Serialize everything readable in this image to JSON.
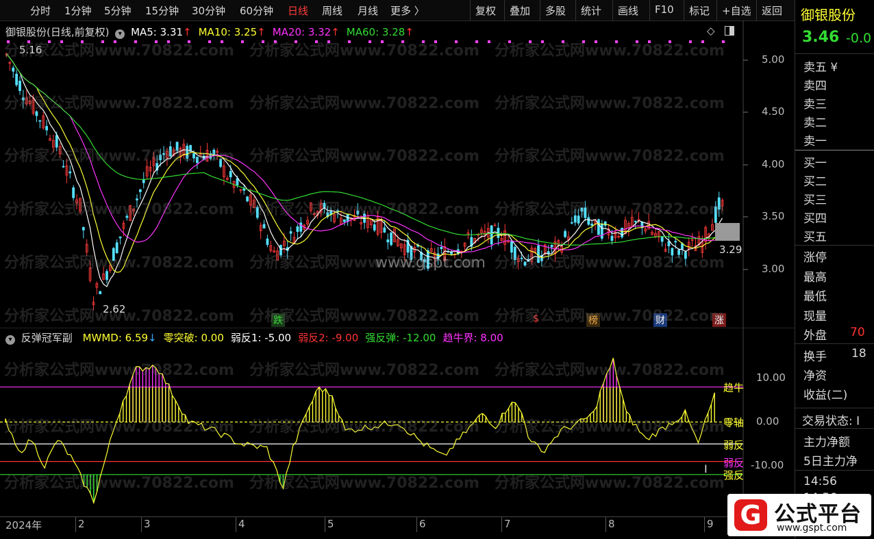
{
  "toolbar": {
    "periods": [
      "分时",
      "1分钟",
      "5分钟",
      "15分钟",
      "30分钟",
      "60分钟",
      "日线",
      "周线",
      "月线",
      "更多 〉"
    ],
    "active_index": 6,
    "actions": [
      "复权",
      "叠加",
      "多股",
      "统计",
      "画线",
      "F10",
      "标记",
      "+自选",
      "返回"
    ]
  },
  "main": {
    "stock_name": "御银股份",
    "mode": "(日线,前复权)",
    "ma": [
      {
        "label": "MA5: 3.31",
        "color": "#ffffff"
      },
      {
        "label": "MA10: 3.25",
        "color": "#ffff33"
      },
      {
        "label": "MA20: 3.32",
        "color": "#ff33ff"
      },
      {
        "label": "MA60: 3.28",
        "color": "#33dd33"
      }
    ],
    "yticks": [
      "5.00",
      "4.50",
      "4.00",
      "3.50",
      "3.00"
    ],
    "annot_high": "5.16",
    "annot_low": "2.62",
    "annot_last": "3.29",
    "center_watermark": "www.gspt.com",
    "events": [
      {
        "label": "跌",
        "color": "#33dd33",
        "bg": "#1a3a1a"
      },
      {
        "label": "$",
        "color": "#ff3333",
        "bg": "#000000"
      },
      {
        "label": "榜",
        "color": "#ffaa33",
        "bg": "#3a2a10"
      },
      {
        "label": "财",
        "color": "#ffffff",
        "bg": "#1a3a7a"
      },
      {
        "label": "涨",
        "color": "#ffffff",
        "bg": "#7a1a1a"
      }
    ]
  },
  "sub": {
    "name": "反弹冠军副",
    "items": [
      {
        "label": "MWMD: 6.59",
        "color": "#ffff33"
      },
      {
        "label": "零突破: 0.00",
        "color": "#ffff33"
      },
      {
        "label": "弱反1: -5.00",
        "color": "#ffffff"
      },
      {
        "label": "弱反2: -9.00",
        "color": "#ff3333"
      },
      {
        "label": "强反弹: -12.00",
        "color": "#33dd33"
      },
      {
        "label": "趋牛界: 8.00",
        "color": "#ff33ff"
      }
    ],
    "yticks": [
      "10.00",
      "0.00",
      "-10.00"
    ],
    "line_labels": [
      {
        "label": "趋牛",
        "color": "#ffff33"
      },
      {
        "label": "零轴",
        "color": "#ffff33"
      },
      {
        "label": "弱反",
        "color": "#ffff33"
      },
      {
        "label": "弱反",
        "color": "#ff33ff"
      },
      {
        "label": "强反",
        "color": "#ffff33"
      }
    ]
  },
  "xaxis": [
    "2024年",
    "2",
    "3",
    "4",
    "5",
    "6",
    "7",
    "8",
    "9"
  ],
  "watermark_text": "分析家公式网www.70822.com",
  "right": {
    "name": "御银股份",
    "price": "3.46",
    "change": "-0.0",
    "sell": [
      "卖五 ¥",
      "卖四",
      "卖三",
      "卖二",
      "卖一"
    ],
    "buy": [
      "买一",
      "买二",
      "买三",
      "买四",
      "买五"
    ],
    "stats": [
      "涨停",
      "最高",
      "最低",
      "现量",
      "外盘"
    ],
    "outer_value": "70",
    "more": [
      "换手",
      "净资",
      "收益(二)"
    ],
    "turnover_value": "18",
    "trade_status": "交易状态: I",
    "flow": [
      "主力净额",
      "5日主力净"
    ],
    "time1": "14:56",
    "time2": "14:56"
  },
  "logo": {
    "brand": "公式平台",
    "url": "www.gspt.com"
  }
}
